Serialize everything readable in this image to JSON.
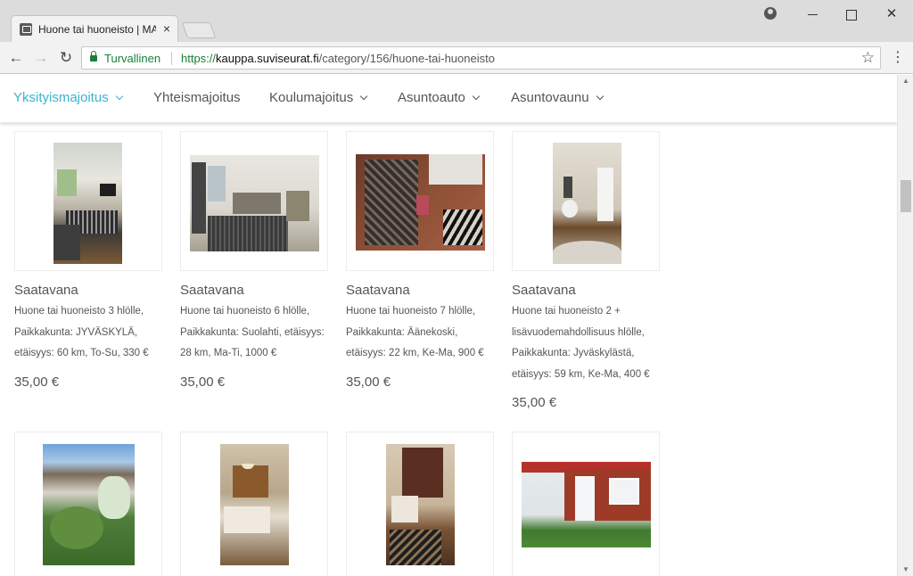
{
  "browser": {
    "tab_title": "Huone tai huoneisto | MA",
    "tab_close": "×",
    "secure_label": "Turvallinen",
    "url_scheme": "https://",
    "url_host": "kauppa.suviseurat.fi",
    "url_path": "/category/156/huone-tai-huoneisto",
    "back_glyph": "←",
    "forward_glyph": "→",
    "reload_glyph": "↻",
    "star_glyph": "☆",
    "menu_glyph": "⋮",
    "close_glyph": "✕",
    "icons": [
      "tab-favicon",
      "close-icon",
      "profile-icon",
      "minimize-icon",
      "maximize-icon",
      "close-window-icon",
      "back-icon",
      "forward-icon",
      "reload-icon",
      "lock-icon",
      "star-icon",
      "menu-icon"
    ]
  },
  "nav": {
    "items": [
      {
        "label": "Yksityismajoitus",
        "has_dropdown": true,
        "active": true
      },
      {
        "label": "Yhteismajoitus",
        "has_dropdown": false,
        "active": false
      },
      {
        "label": "Koulumajoitus",
        "has_dropdown": true,
        "active": false
      },
      {
        "label": "Asuntoauto",
        "has_dropdown": true,
        "active": false
      },
      {
        "label": "Asuntovaunu",
        "has_dropdown": true,
        "active": false
      }
    ],
    "active_color": "#3bb3cf"
  },
  "products": [
    {
      "title": "Saatavana",
      "desc": [
        "Huone tai huoneisto 3 hlölle,",
        "Paikkakunta: JYVÄSKYLÄ,",
        "etäisyys: 60 km, To-Su, 330 €"
      ],
      "price": "35,00 €"
    },
    {
      "title": "Saatavana",
      "desc": [
        "Huone tai huoneisto 6 hlölle,",
        "Paikkakunta: Suolahti, etäisyys:",
        "28 km, Ma-Ti, 1000 €"
      ],
      "price": "35,00 €"
    },
    {
      "title": "Saatavana",
      "desc": [
        "Huone tai huoneisto 7 hlölle,",
        "Paikkakunta: Äänekoski,",
        "etäisyys: 22 km, Ke-Ma, 900 €"
      ],
      "price": "35,00 €"
    },
    {
      "title": "Saatavana",
      "desc": [
        "Huone tai huoneisto 2 +",
        "lisävuodemahdollisuus hlölle,",
        "Paikkakunta: Jyväskylästä,",
        "etäisyys: 59 km, Ke-Ma, 400 €"
      ],
      "price": "35,00 €"
    }
  ],
  "scrollbar": {
    "up": "▲",
    "down": "▼"
  }
}
